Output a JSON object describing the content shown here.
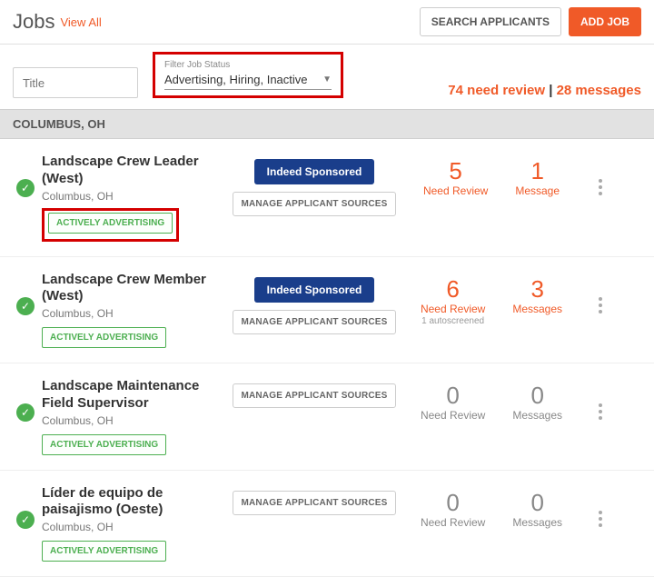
{
  "header": {
    "title": "Jobs",
    "viewAll": "View All",
    "searchApplicants": "SEARCH APPLICANTS",
    "addJob": "ADD JOB"
  },
  "filter": {
    "titlePlaceholder": "Title",
    "label": "Filter Job Status",
    "value": "Advertising, Hiring, Inactive"
  },
  "summary": {
    "reviewCount": "74",
    "reviewLabel": " need review",
    "divider": " | ",
    "msgCount": "28",
    "msgLabel": " messages"
  },
  "section": "COLUMBUS, OH",
  "labels": {
    "indeed": "Indeed Sponsored",
    "manage": "MANAGE APPLICANT SOURCES",
    "badge": "ACTIVELY ADVERTISING",
    "needReview": "Need Review",
    "message": "Message",
    "messages": "Messages",
    "autoscreened": "1 autoscreened"
  },
  "jobs": [
    {
      "title": "Landscape Crew Leader (West)",
      "loc": "Columbus, OH",
      "review": "5",
      "msgs": "1",
      "msgLabel": "Message",
      "sponsored": true,
      "redBadge": true
    },
    {
      "title": "Landscape Crew Member (West)",
      "loc": "Columbus, OH",
      "review": "6",
      "msgs": "3",
      "msgLabel": "Messages",
      "sponsored": true,
      "autoscreened": true
    },
    {
      "title": "Landscape Maintenance Field Supervisor",
      "loc": "Columbus, OH",
      "review": "0",
      "msgs": "0",
      "msgLabel": "Messages",
      "sponsored": false,
      "muted": true
    },
    {
      "title": "Líder de equipo de paisajismo (Oeste)",
      "loc": "Columbus, OH",
      "review": "0",
      "msgs": "0",
      "msgLabel": "Messages",
      "sponsored": false,
      "muted": true
    }
  ]
}
